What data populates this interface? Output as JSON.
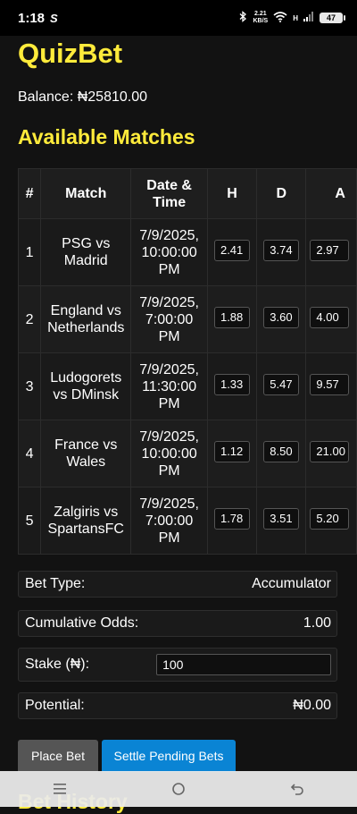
{
  "status_bar": {
    "time": "1:18",
    "app_glyph": "S",
    "net_speed_value": "2.21",
    "net_speed_unit": "KB/S",
    "signal_label": "H",
    "battery": "47"
  },
  "app": {
    "title": "QuizBet",
    "balance": "Balance: ₦25810.00"
  },
  "matches_section": {
    "title": "Available Matches",
    "headers": {
      "num": "#",
      "match": "Match",
      "date": "Date & Time",
      "home": "H",
      "draw": "D",
      "away": "A"
    },
    "rows": [
      {
        "num": "1",
        "match": "PSG vs Madrid",
        "date": "7/9/2025, 10:00:00 PM",
        "h": "2.41",
        "d": "3.74",
        "a": "2.97"
      },
      {
        "num": "2",
        "match": "England vs Netherlands",
        "date": "7/9/2025, 7:00:00 PM",
        "h": "1.88",
        "d": "3.60",
        "a": "4.00"
      },
      {
        "num": "3",
        "match": "Ludogorets vs DMinsk",
        "date": "7/9/2025, 11:30:00 PM",
        "h": "1.33",
        "d": "5.47",
        "a": "9.57"
      },
      {
        "num": "4",
        "match": "France vs Wales",
        "date": "7/9/2025, 10:00:00 PM",
        "h": "1.12",
        "d": "8.50",
        "a": "21.00"
      },
      {
        "num": "5",
        "match": "Zalgiris vs SpartansFC",
        "date": "7/9/2025, 7:00:00 PM",
        "h": "1.78",
        "d": "3.51",
        "a": "5.20"
      }
    ]
  },
  "bet_slip": {
    "bet_type_label": "Bet Type:",
    "bet_type_value": "Accumulator",
    "cumulative_odds_label": "Cumulative Odds:",
    "cumulative_odds_value": "1.00",
    "stake_label": "Stake (₦):",
    "stake_value": "100",
    "potential_label": "Potential:",
    "potential_value": "₦0.00",
    "place_bet_label": "Place Bet",
    "settle_label": "Settle Pending Bets"
  },
  "history": {
    "title": "Bet History"
  },
  "nav_bar": {
    "icons": [
      "menu-icon",
      "home-circle-icon",
      "back-icon"
    ]
  },
  "colors": {
    "accent": "#ffeb3b",
    "settle_button": "#0a84d4",
    "place_button": "#555555",
    "background": "#121212"
  }
}
